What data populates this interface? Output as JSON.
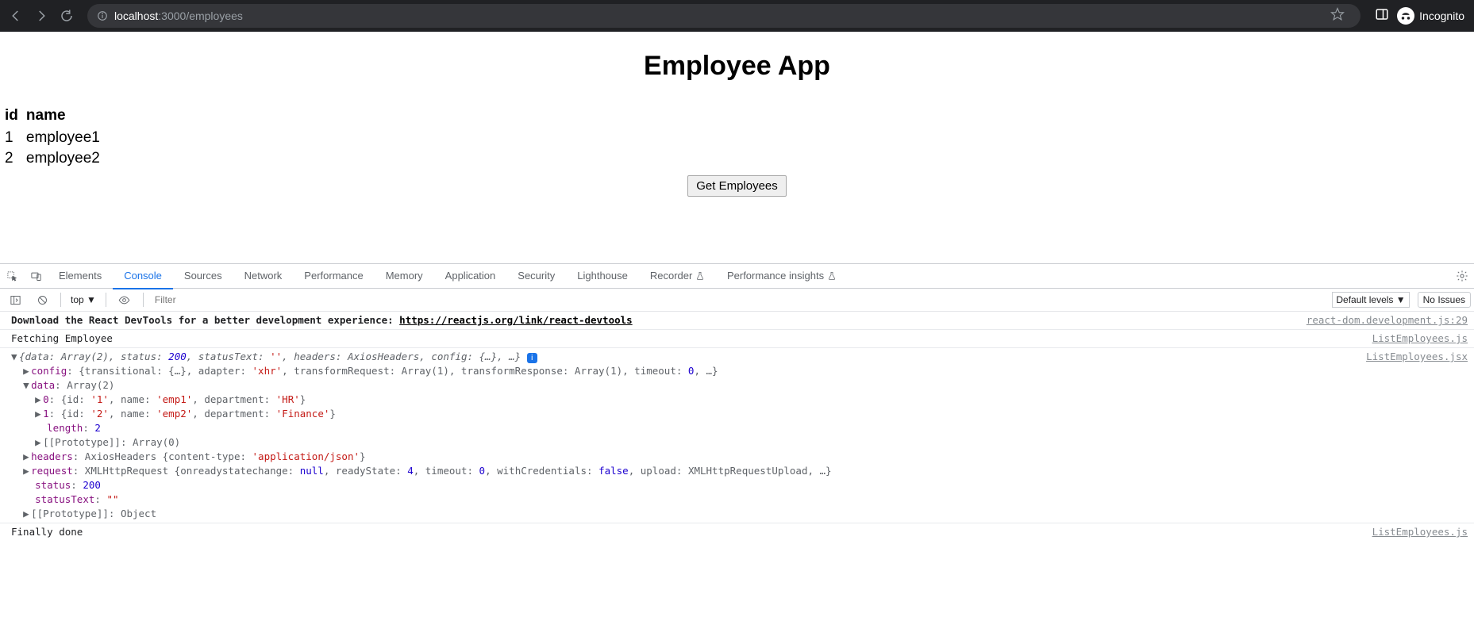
{
  "browser": {
    "url_host": "localhost",
    "url_port": ":3000",
    "url_path": "/employees",
    "incognito_label": "Incognito"
  },
  "page": {
    "title": "Employee App",
    "table": {
      "headers": {
        "id": "id",
        "name": "name"
      },
      "rows": [
        {
          "id": "1",
          "name": "employee1"
        },
        {
          "id": "2",
          "name": "employee2"
        }
      ]
    },
    "get_button": "Get Employees"
  },
  "devtools": {
    "tabs": [
      "Elements",
      "Console",
      "Sources",
      "Network",
      "Performance",
      "Memory",
      "Application",
      "Security",
      "Lighthouse",
      "Recorder",
      "Performance insights"
    ],
    "flask_tabs": [
      9,
      10
    ],
    "active_tab": 1,
    "context": "top",
    "filter_placeholder": "Filter",
    "levels_label": "Default levels",
    "issues_label": "No Issues",
    "log": {
      "l1_text": "Download the React DevTools for a better development experience: ",
      "l1_link": "https://reactjs.org/link/react-devtools",
      "l1_src": "react-dom.development.js:29",
      "l2_text": "Fetching Employee",
      "l2_src": "ListEmployees.js",
      "obj_src": "ListEmployees.jsx",
      "obj_summary_pre": "{data: Array(2), status: 200, statusText: '', headers: AxiosHeaders, config: {…}, …}",
      "config_line": "config: {transitional: {…}, adapter: 'xhr', transformRequest: Array(1), transformResponse: Array(1), timeout: 0, …}",
      "data_head": "data: Array(2)",
      "e0": "0: {id: '1', name: 'emp1', department: 'HR'}",
      "e1": "1: {id: '2', name: 'emp2', department: 'Finance'}",
      "length_line": "length: 2",
      "proto_arr": "[[Prototype]]: Array(0)",
      "headers_line": "headers: AxiosHeaders {content-type: 'application/json'}",
      "request_line": "request: XMLHttpRequest {onreadystatechange: null, readyState: 4, timeout: 0, withCredentials: false, upload: XMLHttpRequestUpload, …}",
      "status_line": "status: 200",
      "statustext_line": "statusText: \"\"",
      "proto_obj": "[[Prototype]]: Object",
      "l_last": "Finally done",
      "l_last_src": "ListEmployees.js"
    }
  }
}
